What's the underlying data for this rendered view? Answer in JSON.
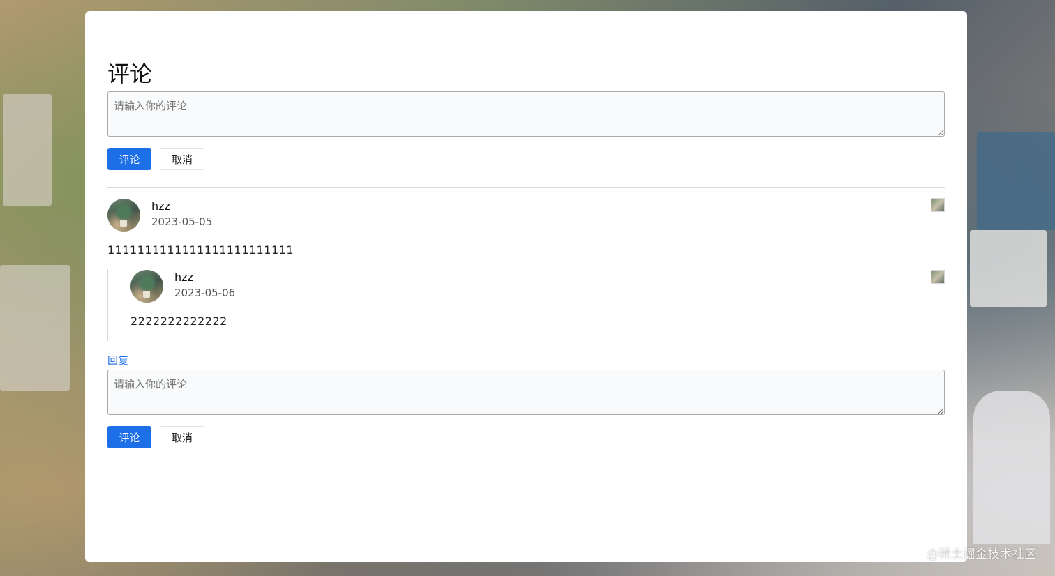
{
  "colors": {
    "primary": "#1d6fe8",
    "card_bg": "#ffffff",
    "link": "#1d6fe8"
  },
  "page": {
    "title": "评论"
  },
  "top_form": {
    "placeholder": "请输入你的评论",
    "submit_label": "评论",
    "cancel_label": "取消"
  },
  "comments": [
    {
      "username": "hzz",
      "date": "2023-05-05",
      "text": "1111111111111111111111111",
      "avatar_icon": "user-avatar",
      "thumb_icon": "image-thumbnail-icon",
      "replies": [
        {
          "username": "hzz",
          "date": "2023-05-06",
          "text": "2222222222222",
          "avatar_icon": "user-avatar",
          "thumb_icon": "image-thumbnail-icon"
        }
      ],
      "reply_label": "回复",
      "reply_form": {
        "placeholder": "请输入你的评论",
        "submit_label": "评论",
        "cancel_label": "取消"
      }
    }
  ],
  "watermark": "@稀土掘金技术社区"
}
